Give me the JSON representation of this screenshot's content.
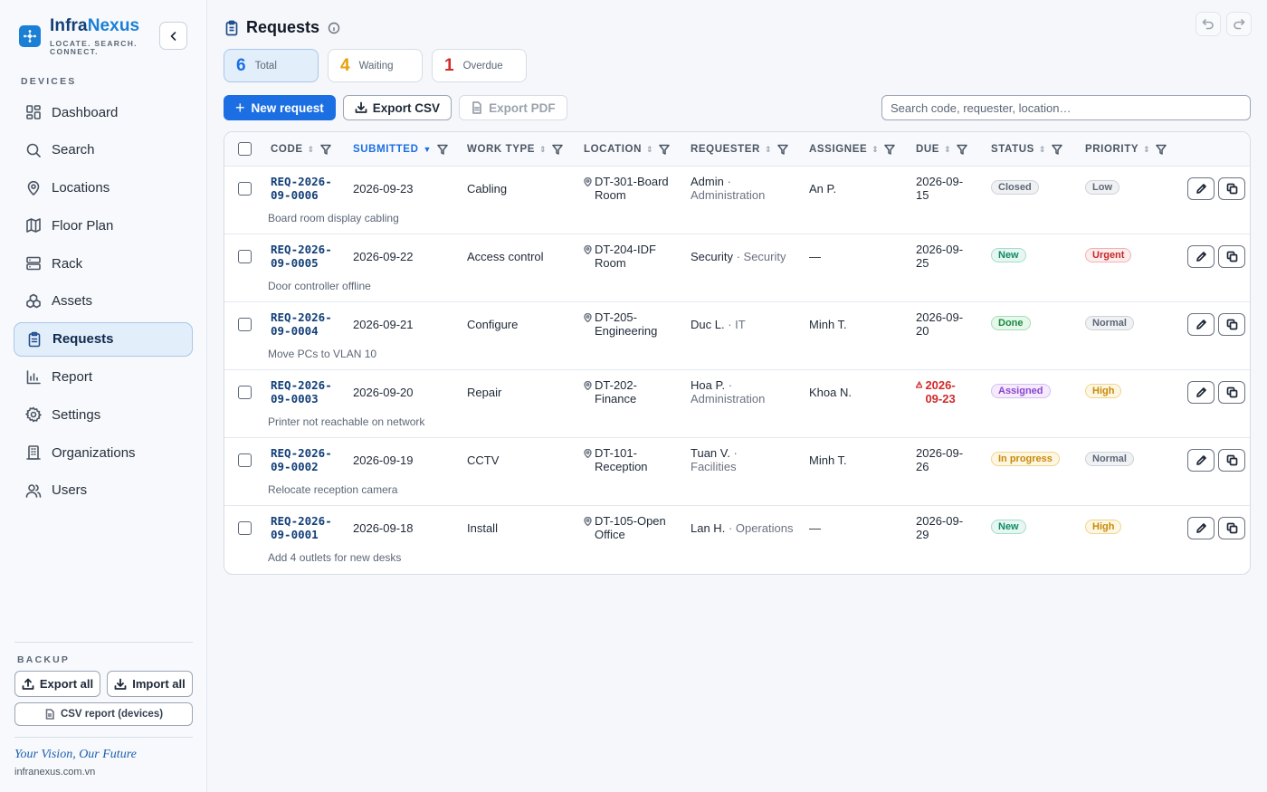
{
  "brand": {
    "name_a": "Infra",
    "name_b": "Nexus",
    "tagline": "LOCATE. SEARCH. CONNECT."
  },
  "sidebar": {
    "section_label": "DEVICES",
    "items": [
      {
        "label": "Dashboard",
        "icon": "dashboard-icon"
      },
      {
        "label": "Search",
        "icon": "search-icon"
      },
      {
        "label": "Locations",
        "icon": "map-pin-icon"
      },
      {
        "label": "Floor Plan",
        "icon": "map-icon"
      },
      {
        "label": "Rack",
        "icon": "server-icon"
      },
      {
        "label": "Assets",
        "icon": "boxes-icon"
      },
      {
        "label": "Requests",
        "icon": "clipboard-icon",
        "active": true
      },
      {
        "label": "Report",
        "icon": "bar-chart-icon"
      },
      {
        "label": "Settings",
        "icon": "gear-icon"
      },
      {
        "label": "Organizations",
        "icon": "building-icon"
      },
      {
        "label": "Users",
        "icon": "users-icon"
      }
    ],
    "backup": {
      "label": "BACKUP",
      "export_all": "Export all",
      "import_all": "Import all",
      "csv_report": "CSV report (devices)"
    },
    "motto": "Your Vision, Our Future",
    "site": "infranexus.com.vn"
  },
  "header": {
    "title": "Requests"
  },
  "stats": [
    {
      "value": "6",
      "label": "Total",
      "color": "#1b6fe3"
    },
    {
      "value": "4",
      "label": "Waiting",
      "color": "#e8a008"
    },
    {
      "value": "1",
      "label": "Overdue",
      "color": "#d12a2a"
    }
  ],
  "toolbar": {
    "new_request": "New request",
    "export_csv": "Export CSV",
    "export_pdf": "Export PDF",
    "search_placeholder": "Search code, requester, location…"
  },
  "table": {
    "columns": [
      "CODE",
      "SUBMITTED",
      "WORK TYPE",
      "LOCATION",
      "REQUESTER",
      "ASSIGNEE",
      "DUE",
      "STATUS",
      "PRIORITY"
    ],
    "sorted_column": "SUBMITTED",
    "rows": [
      {
        "code": "REQ-2026-09-0006",
        "submitted": "2026-09-23",
        "work_type": "Cabling",
        "location": "DT-301-Board Room",
        "requester": "Admin",
        "dept": "Administration",
        "assignee": "An P.",
        "due": "2026-09-15",
        "overdue": false,
        "status": "Closed",
        "priority": "Low",
        "desc": "Board room display cabling"
      },
      {
        "code": "REQ-2026-09-0005",
        "submitted": "2026-09-22",
        "work_type": "Access control",
        "location": "DT-204-IDF Room",
        "requester": "Security",
        "dept": "Security",
        "assignee": "—",
        "due": "2026-09-25",
        "overdue": false,
        "status": "New",
        "priority": "Urgent",
        "desc": "Door controller offline"
      },
      {
        "code": "REQ-2026-09-0004",
        "submitted": "2026-09-21",
        "work_type": "Configure",
        "location": "DT-205-Engineering",
        "requester": "Duc L.",
        "dept": "IT",
        "assignee": "Minh T.",
        "due": "2026-09-20",
        "overdue": false,
        "status": "Done",
        "priority": "Normal",
        "desc": "Move PCs to VLAN 10"
      },
      {
        "code": "REQ-2026-09-0003",
        "submitted": "2026-09-20",
        "work_type": "Repair",
        "location": "DT-202-Finance",
        "requester": "Hoa P.",
        "dept": "Administration",
        "assignee": "Khoa N.",
        "due": "2026-09-23",
        "overdue": true,
        "status": "Assigned",
        "priority": "High",
        "desc": "Printer not reachable on network"
      },
      {
        "code": "REQ-2026-09-0002",
        "submitted": "2026-09-19",
        "work_type": "CCTV",
        "location": "DT-101-Reception",
        "requester": "Tuan V.",
        "dept": "Facilities",
        "assignee": "Minh T.",
        "due": "2026-09-26",
        "overdue": false,
        "status": "In progress",
        "priority": "Normal",
        "desc": "Relocate reception camera"
      },
      {
        "code": "REQ-2026-09-0001",
        "submitted": "2026-09-18",
        "work_type": "Install",
        "location": "DT-105-Open Office",
        "requester": "Lan H.",
        "dept": "Operations",
        "assignee": "—",
        "due": "2026-09-29",
        "overdue": false,
        "status": "New",
        "priority": "High",
        "desc": "Add 4 outlets for new desks"
      }
    ]
  }
}
